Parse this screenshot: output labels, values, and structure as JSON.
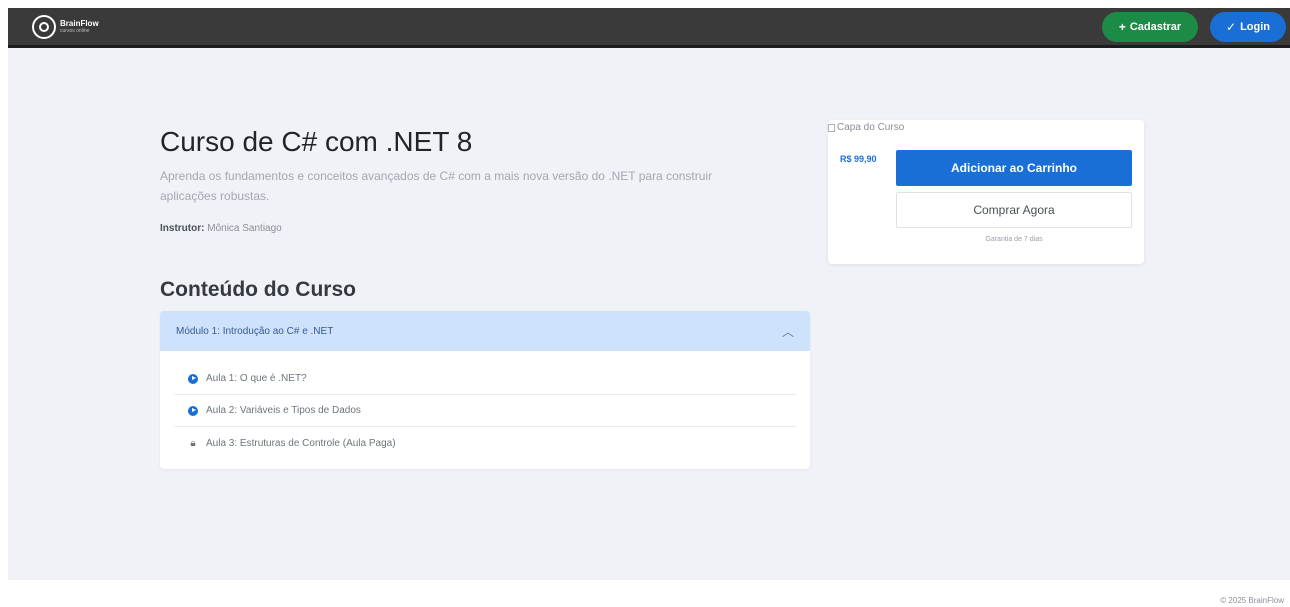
{
  "navbar": {
    "brand_name": "BrainFlow",
    "brand_tag": "cursos online",
    "signup_label": "Cadastrar",
    "signup_icon": "plus-icon",
    "login_label": "Login",
    "login_icon": "check-icon",
    "colors": {
      "bar": "#3a3a3a",
      "signup": "#1c8b45",
      "login": "#1a6fd6"
    }
  },
  "course": {
    "title": "Curso de C# com .NET 8",
    "description": "Aprenda os fundamentos e conceitos avançados de C# com a mais nova versão do .NET para construir aplicações robustas.",
    "instructor_label": "Instrutor:",
    "instructor_name": "Mônica Santiago"
  },
  "content": {
    "section_title": "Conteúdo do Curso",
    "module_title": "Módulo 1: Introdução ao C# e .NET",
    "lessons": [
      {
        "label": "Aula 1: O que é .NET?",
        "icon": "play-circle-icon"
      },
      {
        "label": "Aula 2: Variáveis e Tipos de Dados",
        "icon": "play-circle-icon"
      },
      {
        "label": "Aula 3: Estruturas de Controle (Aula Paga)",
        "icon": "lock-icon"
      }
    ]
  },
  "purchase": {
    "cover_alt": "Capa do Curso",
    "price": "R$ 99,90",
    "cart_label": "Adicionar ao Carrinho",
    "buy_label": "Comprar Agora",
    "guarantee": "Garantia de 7 dias"
  },
  "footer": {
    "copyright": "© 2025 BrainFlow"
  }
}
